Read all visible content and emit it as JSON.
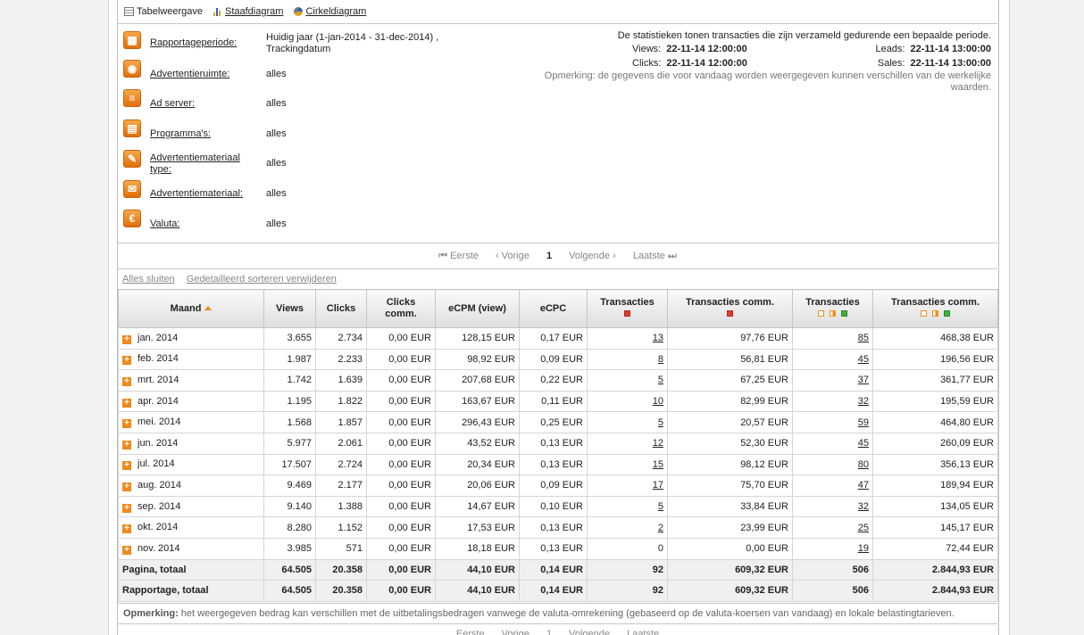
{
  "views": {
    "table": "Tabelweergave",
    "bar": "Staafdiagram",
    "pie": "Cirkeldiagram"
  },
  "filters": [
    {
      "label": "Rapportageperiode:",
      "value": "Huidig jaar (1-jan-2014 - 31-dec-2014) , Trackingdatum",
      "icon": "calendar-icon"
    },
    {
      "label": "Advertentieruimte:",
      "value": "alles",
      "icon": "adspace-icon"
    },
    {
      "label": "Ad server:",
      "value": "alles",
      "icon": "server-icon"
    },
    {
      "label": "Programma's:",
      "value": "alles",
      "icon": "programs-icon"
    },
    {
      "label": "Advertentiemateriaal type:",
      "value": "alles",
      "icon": "material-type-icon"
    },
    {
      "label": "Advertentiemateriaal:",
      "value": "alles",
      "icon": "material-icon"
    },
    {
      "label": "Valuta:",
      "value": "alles",
      "icon": "euro-icon"
    }
  ],
  "stats": {
    "intro": "De statistieken tonen transacties die zijn verzameld gedurende een bepaalde periode.",
    "views_label": "Views:",
    "views_value": "22-11-14 12:00:00",
    "clicks_label": "Clicks:",
    "clicks_value": "22-11-14 12:00:00",
    "leads_label": "Leads:",
    "leads_value": "22-11-14 13:00:00",
    "sales_label": "Sales:",
    "sales_value": "22-11-14 13:00:00",
    "note": "Opmerking: de gegevens die voor vandaag worden weergegeven kunnen verschillen van de werkelijke waarden."
  },
  "pager": {
    "first": "Eerste",
    "prev": "Vorige",
    "page": "1",
    "next": "Volgende",
    "last": "Laatste"
  },
  "links": {
    "close_all": "Alles sluiten",
    "remove_sort": "Gedetailleerd sorteren verwijderen"
  },
  "table": {
    "headers": [
      "Maand",
      "Views",
      "Clicks",
      "Clicks comm.",
      "eCPM (view)",
      "eCPC",
      "Transacties",
      "Transacties comm.",
      "Transacties",
      "Transacties comm."
    ],
    "rows": [
      [
        "jan. 2014",
        "3.655",
        "2.734",
        "0,00 EUR",
        "128,15 EUR",
        "0,17 EUR",
        "13",
        "97,76 EUR",
        "85",
        "468,38 EUR"
      ],
      [
        "feb. 2014",
        "1.987",
        "2.233",
        "0,00 EUR",
        "98,92 EUR",
        "0,09 EUR",
        "8",
        "56,81 EUR",
        "45",
        "196,56 EUR"
      ],
      [
        "mrt. 2014",
        "1.742",
        "1.639",
        "0,00 EUR",
        "207,68 EUR",
        "0,22 EUR",
        "5",
        "67,25 EUR",
        "37",
        "361,77 EUR"
      ],
      [
        "apr. 2014",
        "1.195",
        "1.822",
        "0,00 EUR",
        "163,67 EUR",
        "0,11 EUR",
        "10",
        "82,99 EUR",
        "32",
        "195,59 EUR"
      ],
      [
        "mei. 2014",
        "1.568",
        "1.857",
        "0,00 EUR",
        "296,43 EUR",
        "0,25 EUR",
        "5",
        "20,57 EUR",
        "59",
        "464,80 EUR"
      ],
      [
        "jun. 2014",
        "5.977",
        "2.061",
        "0,00 EUR",
        "43,52 EUR",
        "0,13 EUR",
        "12",
        "52,30 EUR",
        "45",
        "260,09 EUR"
      ],
      [
        "jul. 2014",
        "17.507",
        "2.724",
        "0,00 EUR",
        "20,34 EUR",
        "0,13 EUR",
        "15",
        "98,12 EUR",
        "80",
        "356,13 EUR"
      ],
      [
        "aug. 2014",
        "9.469",
        "2.177",
        "0,00 EUR",
        "20,06 EUR",
        "0,09 EUR",
        "17",
        "75,70 EUR",
        "47",
        "189,94 EUR"
      ],
      [
        "sep. 2014",
        "9.140",
        "1.388",
        "0,00 EUR",
        "14,67 EUR",
        "0,10 EUR",
        "5",
        "33,84 EUR",
        "32",
        "134,05 EUR"
      ],
      [
        "okt. 2014",
        "8.280",
        "1.152",
        "0,00 EUR",
        "17,53 EUR",
        "0,13 EUR",
        "2",
        "23,99 EUR",
        "25",
        "145,17 EUR"
      ],
      [
        "nov. 2014",
        "3.985",
        "571",
        "0,00 EUR",
        "18,18 EUR",
        "0,13 EUR",
        "0",
        "0,00 EUR",
        "19",
        "72,44 EUR"
      ]
    ],
    "totals": [
      [
        "Pagina, totaal",
        "64.505",
        "20.358",
        "0,00 EUR",
        "44,10 EUR",
        "0,14 EUR",
        "92",
        "609,32 EUR",
        "506",
        "2.844,93 EUR"
      ],
      [
        "Rapportage, totaal",
        "64.505",
        "20.358",
        "0,00 EUR",
        "44,10 EUR",
        "0,14 EUR",
        "92",
        "609,32 EUR",
        "506",
        "2.844,93 EUR"
      ]
    ]
  },
  "footnote": {
    "label": "Opmerking:",
    "text": "het weergegeven bedrag kan verschillen met de uitbetalingsbedragen vanwege de valuta-omrekening (gebaseerd op de valuta-koersen van vandaag) en lokale belastingtarieven."
  },
  "colors": {
    "accent": "#f08a1c",
    "red": "#e03b2e",
    "green": "#40b040"
  }
}
